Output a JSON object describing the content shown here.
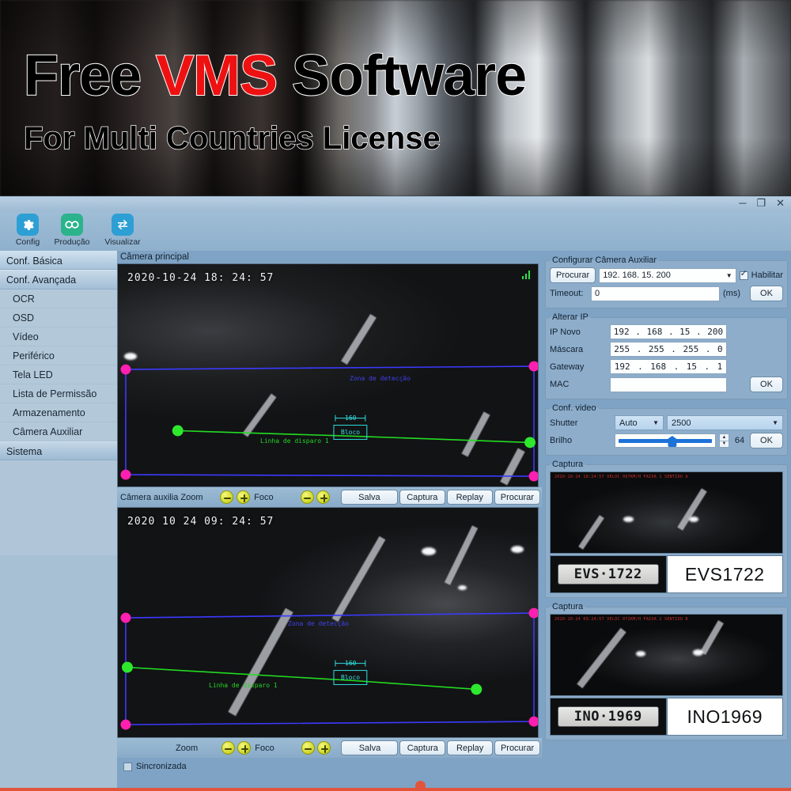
{
  "banner": {
    "title_part1": "Free ",
    "title_highlight": "VMS",
    "title_part2": " Software",
    "subtitle": "For Multi Countries License",
    "highlight_color": "#ee1111"
  },
  "window": {
    "minimize": "─",
    "maximize": "❐",
    "close": "✕"
  },
  "toolbar": {
    "items": [
      {
        "label": "Config",
        "icon": "gear-icon",
        "color": "#2e9fd4"
      },
      {
        "label": "Produção",
        "icon": "infinity-icon",
        "color": "#2bb38c"
      },
      {
        "label": "Visualizar",
        "icon": "swap-arrows-icon",
        "color": "#2e9fd4"
      }
    ]
  },
  "sidebar": {
    "header": "Conf. Básica",
    "subheader": "Conf. Avançada",
    "items": [
      {
        "label": "OCR"
      },
      {
        "label": "OSD"
      },
      {
        "label": "Vídeo"
      },
      {
        "label": "Periférico"
      },
      {
        "label": "Tela LED"
      },
      {
        "label": "Lista de Permissão"
      },
      {
        "label": "Armazenamento"
      },
      {
        "label": "Câmera Auxiliar"
      }
    ],
    "footer": "Sistema"
  },
  "main_camera": {
    "label": "Câmera principal",
    "timestamp": "2020-10-24  18: 24: 57",
    "overlay": {
      "zone_label": "Zona de detecção",
      "trigger_label": "Linha de disparo 1",
      "measure_label": "160",
      "box_label": "Bloco"
    },
    "controls": {
      "zoom_label": "Câmera auxilia Zoom",
      "foco_label": "Foco",
      "buttons": [
        "Salva",
        "Captura",
        "Replay",
        "Procurar"
      ]
    }
  },
  "aux_camera": {
    "timestamp": "2020 10 24  09: 24: 57",
    "overlay": {
      "zone_label": "Zona de detecção",
      "trigger_label": "Linha de disparo 1",
      "measure_label": "160",
      "box_label": "Bloco"
    },
    "controls": {
      "zoom_label": "Zoom",
      "foco_label": "Foco",
      "buttons": [
        "Salva",
        "Captura",
        "Replay",
        "Procurar"
      ]
    },
    "sync_checkbox_label": "Sincronizada"
  },
  "config_aux": {
    "legend": "Configurar Câmera Auxiliar",
    "search_button": "Procurar",
    "ip_value": "192. 168. 15. 200",
    "enable_label": "Habilitar",
    "enable_checked": true,
    "timeout_label": "Timeout:",
    "timeout_value": "0",
    "timeout_unit": "(ms)",
    "ok_label": "OK"
  },
  "alterar_ip": {
    "legend": "Alterar IP",
    "fields": [
      {
        "label": "IP Novo",
        "octets": [
          "192",
          "168",
          "15",
          "200"
        ]
      },
      {
        "label": "Máscara",
        "octets": [
          "255",
          "255",
          "255",
          "0"
        ]
      },
      {
        "label": "Gateway",
        "octets": [
          "192",
          "168",
          "15",
          "1"
        ]
      }
    ],
    "mac_label": "MAC",
    "mac_value": "",
    "ok_label": "OK"
  },
  "conf_video": {
    "legend": "Conf. video",
    "shutter_label": "Shutter",
    "shutter_mode": "Auto",
    "shutter_value": "2500",
    "brilho_label": "Brilho",
    "brilho_value": "64",
    "ok_label": "OK"
  },
  "captures": [
    {
      "legend": "Captura",
      "osd": "2020-10-24 18:24:57  VELOC 067KM/H  FAIXA 1  SENTIDO A",
      "plate_raw": "EVS·1722",
      "plate_text": "EVS1722"
    },
    {
      "legend": "Captura",
      "osd": "2020-10-24 09:24:57  VELOC 072KM/H  FAIXA 2  SENTIDO B",
      "plate_raw": "INO·1969",
      "plate_text": "INO1969"
    }
  ]
}
